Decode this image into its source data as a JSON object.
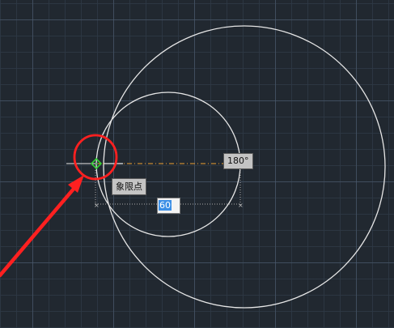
{
  "viewport": {
    "angle_tooltip": "180°",
    "snap_tooltip": "象限点",
    "dynamic_input": {
      "value": "60",
      "selected": true
    }
  },
  "colors": {
    "background": "#212830",
    "geometry": "#e6e6e6",
    "tracking_line": "#f0a030",
    "snap_marker": "#33cc33",
    "annotation": "#ff2020"
  },
  "icons": {
    "snap_marker": "quadrant-snap-icon",
    "callout": "red-circle-highlight",
    "pointer": "red-arrow"
  }
}
